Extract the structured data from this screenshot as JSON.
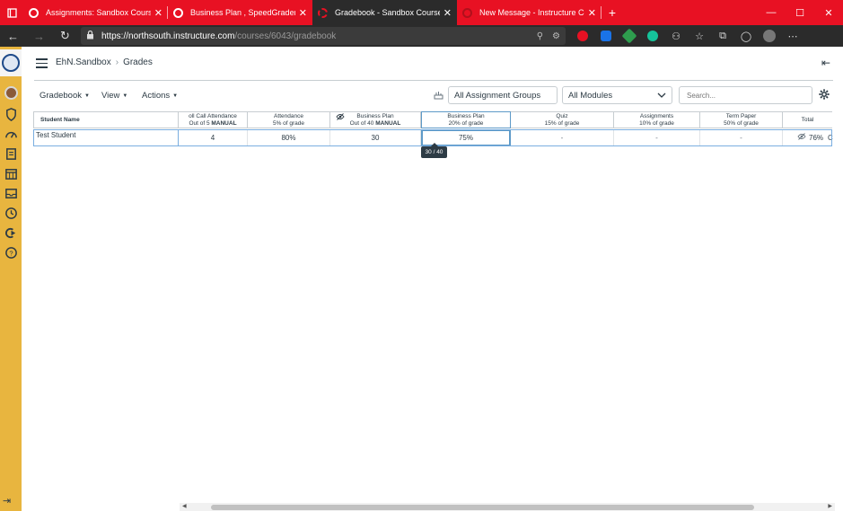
{
  "browser": {
    "tabs": [
      {
        "label": "Assignments: Sandbox Course F...",
        "active": false
      },
      {
        "label": "Business Plan , SpeedGrader, Sa...",
        "active": false
      },
      {
        "label": "Gradebook - Sandbox Course Fo...",
        "active": true
      },
      {
        "label": "New Message - Instructure Comm...",
        "active": false
      }
    ],
    "close_glyph": "✕",
    "new_tab_glyph": "+",
    "url_host": "https://northsouth.instructure.com",
    "url_path": "/courses/6043/gradebook"
  },
  "breadcrumb": {
    "course": "EhN.Sandbox",
    "separator": "›",
    "page": "Grades"
  },
  "toolbar": {
    "gradebook_label": "Gradebook",
    "view_label": "View",
    "actions_label": "Actions",
    "caret": "▼",
    "assignment_groups_value": "All Assignment Groups",
    "modules_value": "All Modules",
    "search_placeholder": "Search..."
  },
  "grid": {
    "student_header": "Student Name",
    "columns": [
      {
        "title": "oll Call Attendance",
        "sub": "Out of 5",
        "sub_bold": "MANUAL"
      },
      {
        "title": "Attendance",
        "sub": "5% of grade",
        "sub_bold": ""
      },
      {
        "title": "Business Plan",
        "sub": "Out of 40",
        "sub_bold": "MANUAL"
      },
      {
        "title": "Business Plan",
        "sub": "20% of grade",
        "sub_bold": ""
      },
      {
        "title": "Quiz",
        "sub": "15% of grade",
        "sub_bold": ""
      },
      {
        "title": "Assignments",
        "sub": "10% of grade",
        "sub_bold": ""
      },
      {
        "title": "Term Paper",
        "sub": "50% of grade",
        "sub_bold": ""
      },
      {
        "title": "Total",
        "sub": "",
        "sub_bold": ""
      }
    ],
    "rows": [
      {
        "student": "Test Student",
        "cells": [
          "4",
          "80%",
          "30",
          "75%",
          "-",
          "-",
          "-",
          "76%"
        ],
        "total_suffix": "C"
      }
    ],
    "tooltip": "30 / 40"
  },
  "colors": {
    "tab_bar": "#e81123",
    "nav_sidebar": "#e8b53f",
    "selection_border": "#5e9ac8"
  }
}
